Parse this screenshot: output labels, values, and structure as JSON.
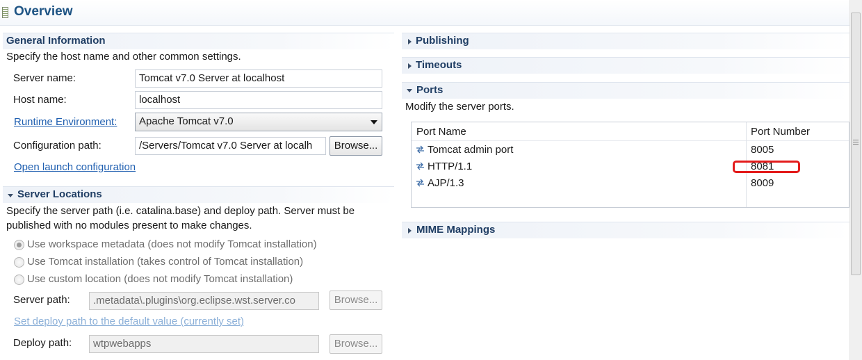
{
  "header": {
    "title": "Overview"
  },
  "general": {
    "title": "General Information",
    "description": "Specify the host name and other common settings.",
    "server_name_label": "Server name:",
    "server_name_value": "Tomcat v7.0 Server at localhost",
    "host_name_label": "Host name:",
    "host_name_value": "localhost",
    "runtime_label": "Runtime Environment:",
    "runtime_value": "Apache Tomcat v7.0",
    "config_path_label": "Configuration path:",
    "config_path_value": "/Servers/Tomcat v7.0 Server at localh",
    "browse_label": "Browse...",
    "open_launch_link": "Open launch configuration"
  },
  "server_locations": {
    "title": "Server Locations",
    "description_line1": "Specify the server path (i.e. catalina.base) and deploy path. Server must be",
    "description_line2": "published with no modules present to make changes.",
    "options": [
      {
        "label": "Use workspace metadata (does not modify Tomcat installation)",
        "selected": true
      },
      {
        "label": "Use Tomcat installation (takes control of Tomcat installation)",
        "selected": false
      },
      {
        "label": "Use custom location (does not modify Tomcat installation)",
        "selected": false
      }
    ],
    "server_path_label": "Server path:",
    "server_path_value": ".metadata\\.plugins\\org.eclipse.wst.server.co",
    "browse_label": "Browse...",
    "set_deploy_link": "Set deploy path to the default value (currently set)",
    "deploy_path_label": "Deploy path:",
    "deploy_path_value": "wtpwebapps"
  },
  "right": {
    "publishing": "Publishing",
    "timeouts": "Timeouts",
    "ports": "Ports",
    "ports_description": "Modify the server ports.",
    "table_headers": [
      "Port Name",
      "Port Number"
    ],
    "rows": [
      {
        "name": "Tomcat admin port",
        "number": "8005"
      },
      {
        "name": "HTTP/1.1",
        "number": "8081"
      },
      {
        "name": "AJP/1.3",
        "number": "8009"
      }
    ],
    "mime": "MIME Mappings"
  },
  "colors": {
    "title": "#1e5484",
    "section_title": "#203e64",
    "link": "#1f5fb0",
    "highlight": "#e31b1b"
  },
  "icons": [
    "editor-icon",
    "port-icon",
    "chevron-down-icon",
    "chevron-right-icon",
    "dropdown-arrow-icon"
  ]
}
